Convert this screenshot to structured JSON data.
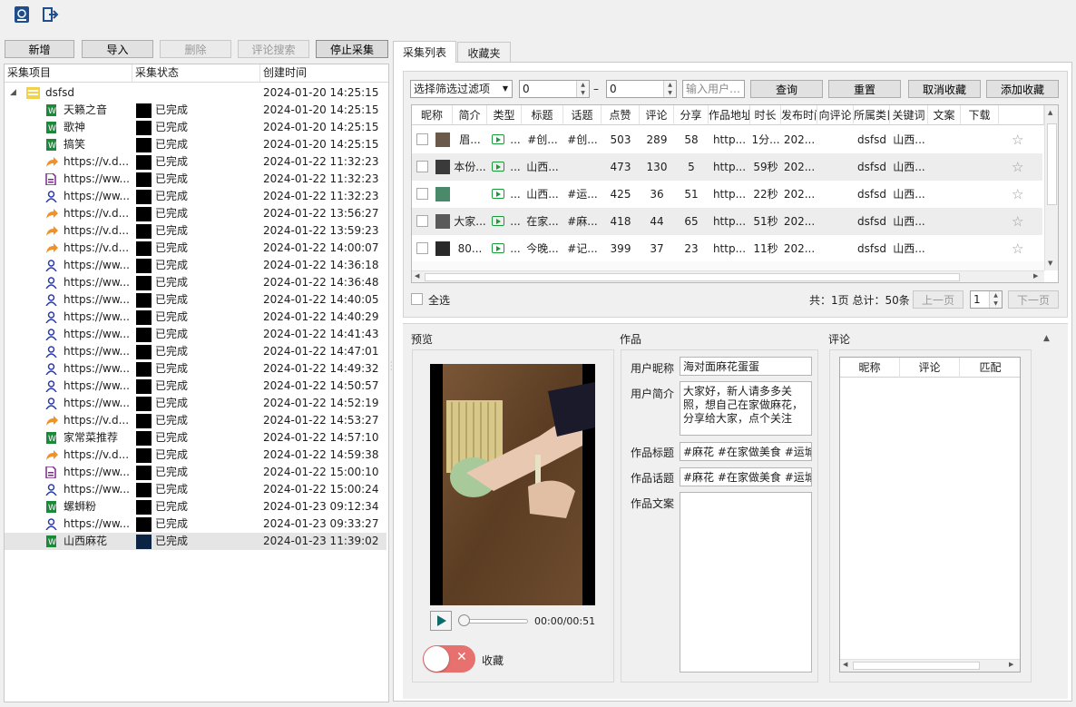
{
  "toolbar": {
    "icon1": "book-icon",
    "icon2": "exit-icon"
  },
  "left": {
    "buttons": {
      "add": "新增",
      "import": "导入",
      "delete": "删除",
      "comment_search": "评论搜索",
      "stop": "停止采集"
    },
    "columns": [
      "采集项目",
      "采集状态",
      "创建时间"
    ],
    "root": {
      "name": "dsfsd",
      "time": "2024-01-20 14:25:15"
    },
    "items": [
      {
        "icon": "word",
        "name": "天籁之音",
        "status": "已完成",
        "time": "2024-01-20 14:25:15"
      },
      {
        "icon": "word",
        "name": "歌神",
        "status": "已完成",
        "time": "2024-01-20 14:25:15"
      },
      {
        "icon": "word",
        "name": "搞笑",
        "status": "已完成",
        "time": "2024-01-20 14:25:15"
      },
      {
        "icon": "share",
        "name": "https://v.d...",
        "status": "已完成",
        "time": "2024-01-22 11:32:23"
      },
      {
        "icon": "doc",
        "name": "https://ww...",
        "status": "已完成",
        "time": "2024-01-22 11:32:23"
      },
      {
        "icon": "user",
        "name": "https://ww...",
        "status": "已完成",
        "time": "2024-01-22 11:32:23"
      },
      {
        "icon": "share",
        "name": "https://v.d...",
        "status": "已完成",
        "time": "2024-01-22 13:56:27"
      },
      {
        "icon": "share",
        "name": "https://v.d...",
        "status": "已完成",
        "time": "2024-01-22 13:59:23"
      },
      {
        "icon": "share",
        "name": "https://v.d...",
        "status": "已完成",
        "time": "2024-01-22 14:00:07"
      },
      {
        "icon": "user",
        "name": "https://ww...",
        "status": "已完成",
        "time": "2024-01-22 14:36:18"
      },
      {
        "icon": "user",
        "name": "https://ww...",
        "status": "已完成",
        "time": "2024-01-22 14:36:48"
      },
      {
        "icon": "user",
        "name": "https://ww...",
        "status": "已完成",
        "time": "2024-01-22 14:40:05"
      },
      {
        "icon": "user",
        "name": "https://ww...",
        "status": "已完成",
        "time": "2024-01-22 14:40:29"
      },
      {
        "icon": "user",
        "name": "https://ww...",
        "status": "已完成",
        "time": "2024-01-22 14:41:43"
      },
      {
        "icon": "user",
        "name": "https://ww...",
        "status": "已完成",
        "time": "2024-01-22 14:47:01"
      },
      {
        "icon": "user",
        "name": "https://ww...",
        "status": "已完成",
        "time": "2024-01-22 14:49:32"
      },
      {
        "icon": "user",
        "name": "https://ww...",
        "status": "已完成",
        "time": "2024-01-22 14:50:57"
      },
      {
        "icon": "user",
        "name": "https://ww...",
        "status": "已完成",
        "time": "2024-01-22 14:52:19"
      },
      {
        "icon": "share",
        "name": "https://v.d...",
        "status": "已完成",
        "time": "2024-01-22 14:53:27"
      },
      {
        "icon": "word",
        "name": "家常菜推荐",
        "status": "已完成",
        "time": "2024-01-22 14:57:10"
      },
      {
        "icon": "share",
        "name": "https://v.d...",
        "status": "已完成",
        "time": "2024-01-22 14:59:38"
      },
      {
        "icon": "doc",
        "name": "https://ww...",
        "status": "已完成",
        "time": "2024-01-22 15:00:10"
      },
      {
        "icon": "user",
        "name": "https://ww...",
        "status": "已完成",
        "time": "2024-01-22 15:00:24"
      },
      {
        "icon": "word",
        "name": "螺蛳粉",
        "status": "已完成",
        "time": "2024-01-23 09:12:34"
      },
      {
        "icon": "user",
        "name": "https://ww...",
        "status": "已完成",
        "time": "2024-01-23 09:33:27"
      },
      {
        "icon": "word",
        "name": "山西麻花",
        "status": "已完成",
        "time": "2024-01-23 11:39:02",
        "selected": true
      }
    ]
  },
  "tabs": [
    "采集列表",
    "收藏夹"
  ],
  "filter": {
    "select": "选择筛选过滤项",
    "from": "0",
    "dash": "–",
    "to": "0",
    "user_placeholder": "输入用户…",
    "query": "查询",
    "reset": "重置",
    "unfav": "取消收藏",
    "fav": "添加收藏"
  },
  "grid": {
    "columns": [
      "昵称",
      "简介",
      "类型",
      "标题",
      "话题",
      "点赞",
      "评论",
      "分享",
      "作品地址",
      "时长",
      "发布时间",
      "向评论",
      "所属类目",
      "关键词",
      "文案",
      "下载"
    ],
    "rows": [
      {
        "nick": "眉...",
        "intro": "",
        "title": "#创...",
        "topic": "#创...",
        "likes": "503",
        "comments": "289",
        "shares": "58",
        "url": "http...",
        "dur": "1分...",
        "pub": "202...",
        "cat": "dsfsd",
        "kw": "山西..."
      },
      {
        "nick": "本份...",
        "intro": "",
        "title": "山西...",
        "topic": "",
        "likes": "473",
        "comments": "130",
        "shares": "5",
        "url": "http...",
        "dur": "59秒",
        "pub": "202...",
        "cat": "dsfsd",
        "kw": "山西..."
      },
      {
        "nick": "",
        "intro": "...",
        "title": "山西...",
        "topic": "#运...",
        "likes": "425",
        "comments": "36",
        "shares": "51",
        "url": "http...",
        "dur": "22秒",
        "pub": "202...",
        "cat": "dsfsd",
        "kw": "山西..."
      },
      {
        "nick": "大家...",
        "intro": "",
        "title": "在家...",
        "topic": "#麻...",
        "likes": "418",
        "comments": "44",
        "shares": "65",
        "url": "http...",
        "dur": "51秒",
        "pub": "202...",
        "cat": "dsfsd",
        "kw": "山西..."
      },
      {
        "nick": "80...",
        "intro": "",
        "title": "今晚...",
        "topic": "#记...",
        "likes": "399",
        "comments": "37",
        "shares": "23",
        "url": "http...",
        "dur": "11秒",
        "pub": "202...",
        "cat": "dsfsd",
        "kw": "山西..."
      }
    ],
    "dots": "...",
    "select_all": "全选",
    "pager": {
      "summary": "共：1页  总计：50条",
      "prev": "上一页",
      "page": "1",
      "next": "下一页"
    }
  },
  "preview": {
    "label": "预览",
    "time": "00:00/00:51",
    "fav_label": "收藏"
  },
  "work": {
    "label": "作品",
    "nick_label": "用户昵称",
    "nick": "海对面麻花蛋蛋",
    "intro_label": "用户简介",
    "intro": "大家好，新人请多多关照，想自己在家做麻花，分享给大家，点个关注",
    "title_label": "作品标题",
    "title": "#麻花 #在家做美食 #运城",
    "topic_label": "作品话题",
    "topic": "#麻花 #在家做美食 #运城",
    "copy_label": "作品文案",
    "copy": ""
  },
  "comments": {
    "label": "评论",
    "columns": [
      "昵称",
      "评论",
      "匹配"
    ]
  }
}
